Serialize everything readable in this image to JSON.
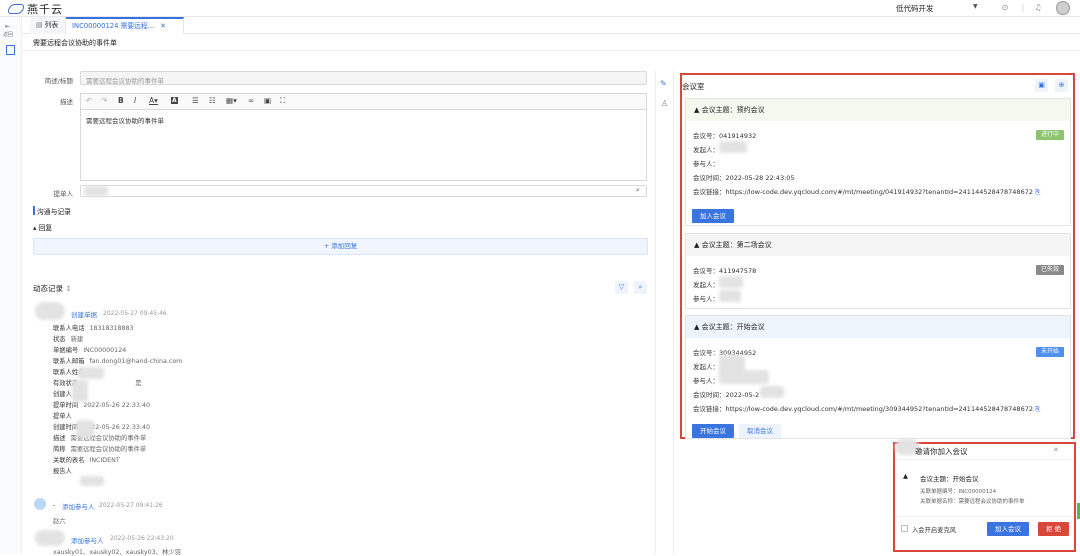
{
  "app": {
    "logo_text": "燕千云",
    "project": "低代码开发"
  },
  "leftbar": {
    "back_label": "返回"
  },
  "tabs": [
    {
      "label": "列表"
    },
    {
      "label": "INC00000124 需要远程..."
    }
  ],
  "page": {
    "title": "需要远程会议协助的事件单"
  },
  "form": {
    "summary_label": "简述/标题",
    "summary_value": "需要远程会议协助的事件单",
    "desc_label": "描述",
    "desc_value": "需要远程会议协助的事件单",
    "submitter_label": "提单人"
  },
  "comm": {
    "title": "沟通与记录",
    "reply_label": "回复",
    "add_reply": "添加回复"
  },
  "activity": {
    "title": "动态记录",
    "entry1": {
      "action": "创建单据",
      "time": "2022-05-27 09:45:46",
      "fields": [
        {
          "k": "联系人电话",
          "v": "18318318883"
        },
        {
          "k": "状态",
          "v": "新建"
        },
        {
          "k": "单据编号",
          "v": "INC00000124"
        },
        {
          "k": "联系人邮箱",
          "v": "fan.dong01@hand-china.com"
        },
        {
          "k": "联系人姓名",
          "v": ""
        },
        {
          "k": "有效状态",
          "v": "是"
        },
        {
          "k": "创建人",
          "v": ""
        },
        {
          "k": "提单时间",
          "v": "2022-05-26 22:33:40"
        },
        {
          "k": "提单人",
          "v": ""
        },
        {
          "k": "创建时间",
          "v": "2022-05-26 22:33:40"
        },
        {
          "k": "描述",
          "v": "需要远程会议协助的事件单"
        },
        {
          "k": "简称",
          "v": "需要远程会议协助的事件单"
        },
        {
          "k": "关联的表名",
          "v": "INCIDENT"
        },
        {
          "k": "报告人",
          "v": ""
        }
      ]
    },
    "entry2": {
      "prefix": "-",
      "action": "添加参与人",
      "time": "2022-05-27 09:41:26",
      "detail": "赵六"
    },
    "entry3": {
      "action": "添加参与人",
      "time": "2022-05-26 22:43:20",
      "detail": "xausky01、xausky02、xausky03、林少羽"
    }
  },
  "room": {
    "title": "会议室",
    "meetings": [
      {
        "topic": "会议主题：预约会议",
        "id_label": "会议号：",
        "id": "041914932",
        "initiator_label": "发起人：",
        "participants_label": "参与人：",
        "time_label": "会议时间：",
        "time": "2022-05-28 22:43:05",
        "link_label": "会议链接：",
        "link": "https://low-code.dev.yqcloud.com/#/mt/meeting/041914932?tenantId=241144528478748672",
        "status": "进行中",
        "status_color": "#8cc56d",
        "btn1": "加入会议"
      },
      {
        "topic": "会议主题：第二场会议",
        "id_label": "会议号：",
        "id": "411947578",
        "initiator_label": "发起人：",
        "participants_label": "参与人：",
        "status": "已失效",
        "status_color": "#8a8a8a"
      },
      {
        "topic": "会议主题：开始会议",
        "id_label": "会议号：",
        "id": "309344952",
        "initiator_label": "发起人：",
        "participants_label": "参与人：",
        "time_label": "会议时间：",
        "time": "2022-05-2",
        "link_label": "会议链接：",
        "link": "https://low-code.dev.yqcloud.com/#/mt/meeting/309344952?tenantId=241144528478748672",
        "status": "未开始",
        "status_color": "#4f8ff0",
        "btn1": "开始会议",
        "btn2": "取消会议"
      }
    ]
  },
  "invite": {
    "title": "邀请你加入会议",
    "topic": "会议主题：开始会议",
    "ticket_label": "关联单据编号：INC00000124",
    "ticket_name": "关联单据名称：需要远程会议协助的事件单",
    "mic_label": "入会开启麦克风",
    "join": "加入会议",
    "reject": "拒 绝"
  },
  "colors": {
    "accent": "#3572e0",
    "highlight_border": "#d9473a"
  }
}
